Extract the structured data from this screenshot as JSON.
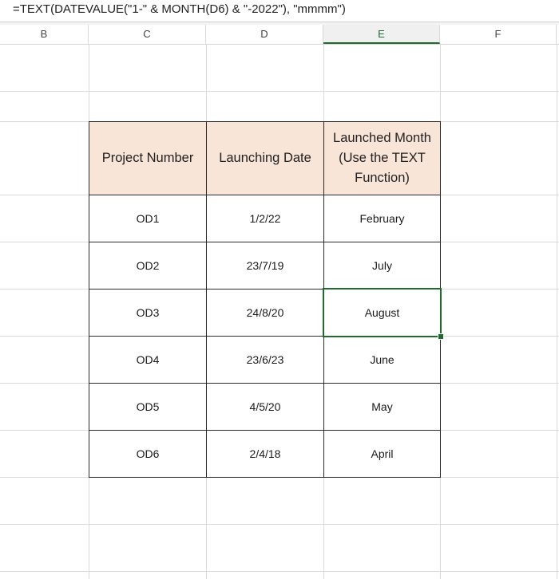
{
  "formula_bar": {
    "formula": "=TEXT(DATEVALUE(\"1-\" & MONTH(D6) & \"-2022\"), \"mmmm\")"
  },
  "column_headers": [
    "B",
    "C",
    "D",
    "E",
    "F"
  ],
  "active_column": "E",
  "table": {
    "headers": [
      "Project Number",
      "Launching Date",
      "Launched Month (Use the TEXT Function)"
    ],
    "header_fill": "#f9e4d8",
    "rows": [
      {
        "project": "OD1",
        "date": "1/2/22",
        "month": "February"
      },
      {
        "project": "OD2",
        "date": "23/7/19",
        "month": "July"
      },
      {
        "project": "OD3",
        "date": "24/8/20",
        "month": "August"
      },
      {
        "project": "OD4",
        "date": "23/6/23",
        "month": "June"
      },
      {
        "project": "OD5",
        "date": "4/5/20",
        "month": "May"
      },
      {
        "project": "OD6",
        "date": "2/4/18",
        "month": "April"
      }
    ]
  },
  "selected_cell": {
    "row_index": 2,
    "column": "E",
    "value": "August"
  },
  "selection_color": "#1e6b2e"
}
